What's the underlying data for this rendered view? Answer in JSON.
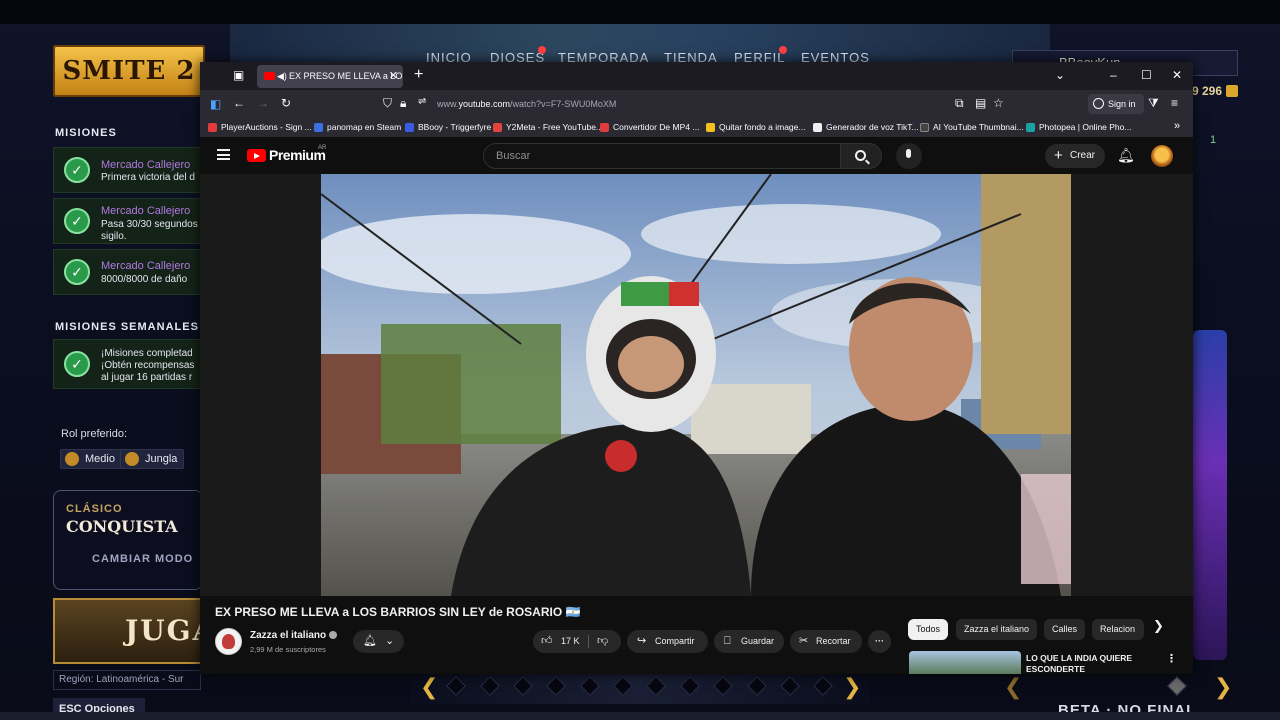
{
  "game": {
    "logo": "SMITE 2",
    "nav": [
      "INICIO",
      "DIOSES",
      "TEMPORADA",
      "TIENDA",
      "PERFIL",
      "EVENTOS"
    ],
    "username": "BBooyKun",
    "currency": "9 296",
    "side_count": "1",
    "missions_title": "MISIONES",
    "missions": [
      {
        "title": "Mercado Callejero",
        "sub1": "Primera victoria del d",
        "sub2": ""
      },
      {
        "title": "Mercado Callejero",
        "sub1": "Pasa 30/30 segundos",
        "sub2": "sigilo."
      },
      {
        "title": "Mercado Callejero",
        "sub1": "8000/8000 de daño",
        "sub2": ""
      }
    ],
    "weekly_title": "MISIONES SEMANALES",
    "weekly": {
      "sub1": "¡Misiones completad",
      "sub2": "¡Obtén recompensas",
      "sub3": "al jugar 16 partidas r"
    },
    "role_label": "Rol preferido:",
    "roles": [
      "Medio",
      "Jungla"
    ],
    "mode_category": "CLÁSICO",
    "mode_name": "CONQUISTA",
    "change_mode": "CAMBIAR MODO",
    "play": "JUGA",
    "region": "Región: Latinoamérica - Sur",
    "esc": "ESC  Opciones",
    "beta": "BETA · NO FINAL"
  },
  "browser": {
    "tab_title": "EX PRESO ME LLEVA a LOS",
    "url_prefix": "www.",
    "url_domain": "youtube.com",
    "url_path": "/watch?v=F7-SWU0MoXM",
    "signin": "Sign in",
    "bookmarks": [
      {
        "label": "PlayerAuctions - Sign ...",
        "color": "#e23b3b"
      },
      {
        "label": "panomap en Steam",
        "color": "#3b6fe2"
      },
      {
        "label": "BBooy - Triggerfyre",
        "color": "#3b5be2"
      },
      {
        "label": "Y2Meta - Free YouTube...",
        "color": "#e2443b"
      },
      {
        "label": "Convertidor De MP4 ...",
        "color": "#e23b3b"
      },
      {
        "label": "Quitar fondo a image...",
        "color": "#f2c11d"
      },
      {
        "label": "Generador de voz TikT...",
        "color": "#eeeeee"
      },
      {
        "label": "AI YouTube Thumbnai...",
        "color": "#444444"
      },
      {
        "label": "Photopea | Online Pho...",
        "color": "#19a3a3"
      }
    ]
  },
  "youtube": {
    "logo": "Premium",
    "country": "AR",
    "search_placeholder": "Buscar",
    "create": "Crear",
    "video_title": "EX PRESO ME LLEVA a LOS BARRIOS SIN LEY de ROSARIO 🇦🇷",
    "channel": "Zazza el italiano",
    "subscribers": "2,99 M de suscriptores",
    "likes": "17 K",
    "share": "Compartir",
    "save": "Guardar",
    "clip": "Recortar",
    "chips": [
      "Todos",
      "Zazza el italiano",
      "Calles",
      "Relacion"
    ],
    "rec_title": "LO QUE LA INDIA QUIERE ESCONDERTE"
  },
  "colors": {
    "accent": "#ff0000",
    "mission_purple": "#b07ae0",
    "gold": "#e3b544"
  }
}
